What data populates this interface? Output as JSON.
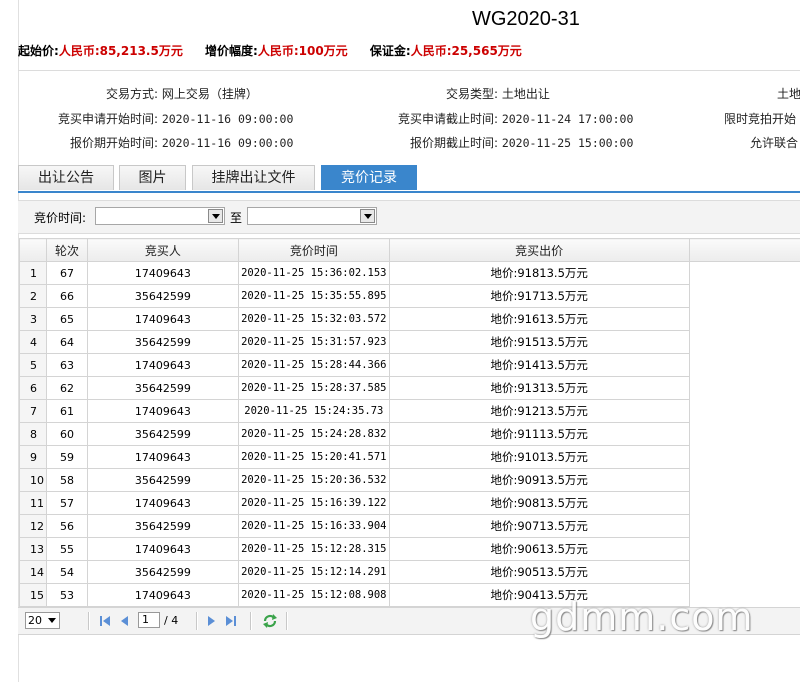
{
  "title": "WG2020-31",
  "price_line": {
    "start_label": "起始价:",
    "start_value": "人民币:85,213.5万元",
    "increment_label": "增价幅度:",
    "increment_value": "人民币:100万元",
    "deposit_label": "保证金:",
    "deposit_value": "人民币:25,565万元"
  },
  "info": {
    "trade_method_label": "交易方式:",
    "trade_method_value": "网上交易（挂牌）",
    "trade_type_label": "交易类型:",
    "trade_type_value": "土地出让",
    "col3_row1": "土地",
    "apply_start_label": "竞买申请开始时间:",
    "apply_start_value": "2020-11-16 09:00:00",
    "apply_end_label": "竞买申请截止时间:",
    "apply_end_value": "2020-11-24 17:00:00",
    "col3_row2": "限时竞拍开始",
    "quote_start_label": "报价期开始时间:",
    "quote_start_value": "2020-11-16 09:00:00",
    "quote_end_label": "报价期截止时间:",
    "quote_end_value": "2020-11-25 15:00:00",
    "col3_row3": "允许联合"
  },
  "tabs": [
    "出让公告",
    "图片",
    "挂牌出让文件",
    "竞价记录"
  ],
  "active_tab": 3,
  "filter": {
    "label": "竞价时间:",
    "to_label": "至"
  },
  "table": {
    "headers": [
      "轮次",
      "竞买人",
      "竞价时间",
      "竞买出价"
    ],
    "rows": [
      [
        "1",
        "67",
        "17409643",
        "2020-11-25 15:36:02.153",
        "地价:91813.5万元"
      ],
      [
        "2",
        "66",
        "35642599",
        "2020-11-25 15:35:55.895",
        "地价:91713.5万元"
      ],
      [
        "3",
        "65",
        "17409643",
        "2020-11-25 15:32:03.572",
        "地价:91613.5万元"
      ],
      [
        "4",
        "64",
        "35642599",
        "2020-11-25 15:31:57.923",
        "地价:91513.5万元"
      ],
      [
        "5",
        "63",
        "17409643",
        "2020-11-25 15:28:44.366",
        "地价:91413.5万元"
      ],
      [
        "6",
        "62",
        "35642599",
        "2020-11-25 15:28:37.585",
        "地价:91313.5万元"
      ],
      [
        "7",
        "61",
        "17409643",
        "2020-11-25 15:24:35.73",
        "地价:91213.5万元"
      ],
      [
        "8",
        "60",
        "35642599",
        "2020-11-25 15:24:28.832",
        "地价:91113.5万元"
      ],
      [
        "9",
        "59",
        "17409643",
        "2020-11-25 15:20:41.571",
        "地价:91013.5万元"
      ],
      [
        "10",
        "58",
        "35642599",
        "2020-11-25 15:20:36.532",
        "地价:90913.5万元"
      ],
      [
        "11",
        "57",
        "17409643",
        "2020-11-25 15:16:39.122",
        "地价:90813.5万元"
      ],
      [
        "12",
        "56",
        "35642599",
        "2020-11-25 15:16:33.904",
        "地价:90713.5万元"
      ],
      [
        "13",
        "55",
        "17409643",
        "2020-11-25 15:12:28.315",
        "地价:90613.5万元"
      ],
      [
        "14",
        "54",
        "35642599",
        "2020-11-25 15:12:14.291",
        "地价:90513.5万元"
      ],
      [
        "15",
        "53",
        "17409643",
        "2020-11-25 15:12:08.908",
        "地价:90413.5万元"
      ]
    ]
  },
  "pager": {
    "page_size": "20",
    "current_page": "1",
    "total_pages": "/ 4"
  },
  "watermark": "gdmm.com",
  "colors": {
    "accent": "#3a86cc",
    "price_red": "#cc0000"
  }
}
